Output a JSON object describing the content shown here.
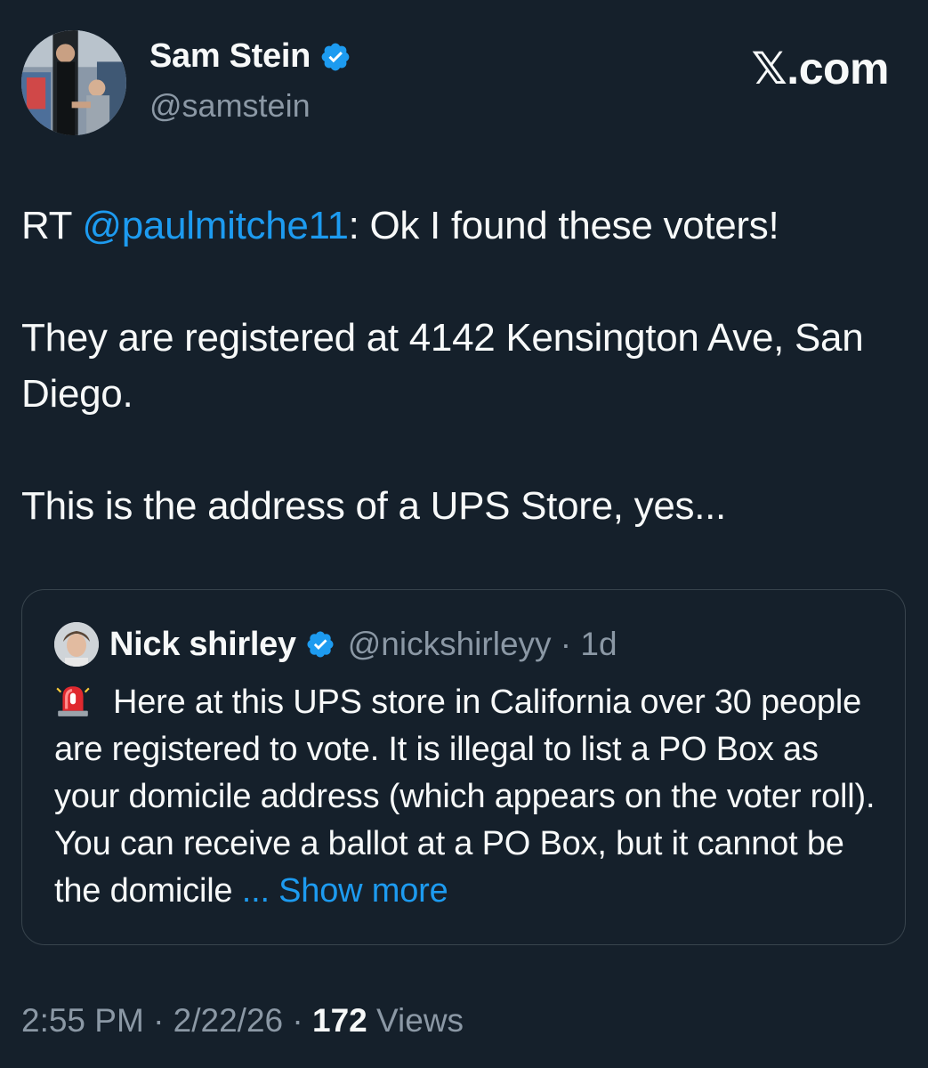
{
  "author": {
    "name": "Sam Stein",
    "handle": "@samstein",
    "avatar_icon": "profile-photo",
    "verified_icon": "verified-badge-icon"
  },
  "brand": "𝕏.com",
  "tweet": {
    "rt_prefix": "RT ",
    "mention": "@paulmitche11",
    "line1_rest": ": Ok I found these voters!",
    "para2": "They are registered at 4142 Kensington Ave, San Diego.",
    "para3": "This is the address of a UPS Store, yes..."
  },
  "quoted": {
    "name": "Nick shirley",
    "handle_time": "@nickshirleyy · 1d",
    "emoji_icon": "siren-icon",
    "text": "Here at this UPS store in California over 30 people are registered to vote. It is illegal to list a PO Box as your domicile address (which appears on the voter roll). You can receive a ballot at a PO Box, but it cannot be the domicile ",
    "show_more": "... Show more"
  },
  "meta": {
    "time_date": "2:55 PM · 2/22/26 · ",
    "views_count": "172",
    "views_label": " Views"
  },
  "colors": {
    "background": "#15202b",
    "text": "#f7f9f9",
    "secondary": "#8b98a5",
    "accent": "#1d9bf0",
    "border": "#38444d"
  }
}
